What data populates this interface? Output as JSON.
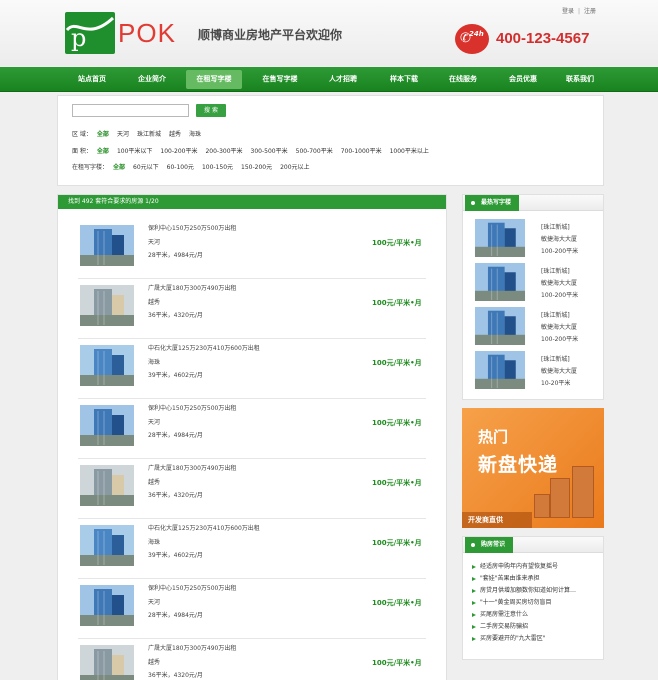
{
  "header": {
    "logo_letter": "p",
    "logo_text": "POK",
    "slogan": "顺博商业房地产平台欢迎你",
    "login": "登录",
    "separator": "|",
    "register": "注册",
    "hotline_badge": "24h",
    "phone": "400-123-4567"
  },
  "nav": [
    "站点首页",
    "企业简介",
    "在租写字楼",
    "在售写字楼",
    "人才招聘",
    "样本下载",
    "在线服务",
    "会员优惠",
    "联系我们"
  ],
  "search": {
    "input_value": "",
    "button": "搜 索",
    "filters": [
      {
        "label": "区 域：",
        "selected": "全部",
        "options": [
          "天河",
          "珠江新城",
          "越秀",
          "海珠"
        ]
      },
      {
        "label": "面 积：",
        "selected": "全部",
        "options": [
          "100平米以下",
          "100-200平米",
          "200-300平米",
          "300-500平米",
          "500-700平米",
          "700-1000平米",
          "1000平米以上"
        ]
      },
      {
        "label": "在租写字楼：",
        "selected": "全部",
        "options": [
          "60元以下",
          "60-100元",
          "100-150元",
          "150-200元",
          "200元以上"
        ]
      }
    ]
  },
  "results": {
    "summary": "找到 492 套符合要求的房源     1/20",
    "items": [
      {
        "name": "保利中心150万250万500万出租",
        "district": "天河",
        "size": "28平米，4984元/月",
        "price": "100元/平米•月"
      },
      {
        "name": "广晟大厦180万300万490万出租",
        "district": "越秀",
        "size": "36平米，4320元/月",
        "price": "100元/平米•月"
      },
      {
        "name": "中石化大厦125万230万410万600万出租",
        "district": "海珠",
        "size": "39平米，4602元/月",
        "price": "100元/平米•月"
      },
      {
        "name": "保利中心150万250万500万出租",
        "district": "天河",
        "size": "28平米，4984元/月",
        "price": "100元/平米•月"
      },
      {
        "name": "广晟大厦180万300万490万出租",
        "district": "越秀",
        "size": "36平米，4320元/月",
        "price": "100元/平米•月"
      },
      {
        "name": "中石化大厦125万230万410万600万出租",
        "district": "海珠",
        "size": "39平米，4602元/月",
        "price": "100元/平米•月"
      },
      {
        "name": "保利中心150万250万500万出租",
        "district": "天河",
        "size": "28平米，4984元/月",
        "price": "100元/平米•月"
      },
      {
        "name": "广晟大厦180万300万490万出租",
        "district": "越秀",
        "size": "36平米，4320元/月",
        "price": "100元/平米•月"
      }
    ]
  },
  "sidebar": {
    "hot_title": "最热写字楼",
    "hot_items": [
      {
        "area": "[珠江新城]",
        "name": "敏捷海大大厦",
        "size": "100-200平米"
      },
      {
        "area": "[珠江新城]",
        "name": "敏捷海大大厦",
        "size": "100-200平米"
      },
      {
        "area": "[珠江新城]",
        "name": "敏捷海大大厦",
        "size": "100-200平米"
      },
      {
        "area": "[珠江新城]",
        "name": "敏捷海大大厦",
        "size": "10-20平米"
      }
    ],
    "banner": {
      "line1": "热门",
      "line2": "新盘快递",
      "tag": "开发商直供"
    },
    "tips_title": "购房常识",
    "tips": [
      "经适房申购年内有望恢复摇号",
      "\"套娃\"苦果由谁来承担",
      "房贷月供增加额数你知道如何计算…",
      "\"十一\"黄金周买房切勿盲目",
      "买尾房需注意什么",
      "二手房交易防骗招",
      "买房要避开的\"九大雷区\""
    ]
  },
  "colors": {
    "brand_green": "#2e9a36",
    "price_green": "#1e8b1e",
    "phone_red": "#d32d2d",
    "banner_orange": "#ea7a1c"
  }
}
